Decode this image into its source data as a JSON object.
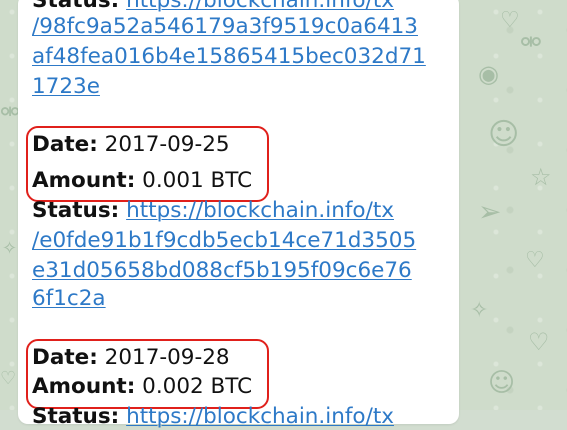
{
  "messages": [
    {
      "status_label": "Status:",
      "link_lines": [
        "https://blockchain.info/tx",
        "/98fc9a52a546179a3f9519c0a6413",
        "af48fea016b4e15865415bec032d71",
        "1723e"
      ]
    },
    {
      "date_label": "Date:",
      "date_value": "2017-09-25",
      "amount_label": "Amount:",
      "amount_value": "0.001 BTC",
      "status_label": "Status:",
      "link_lines": [
        "https://blockchain.info/tx",
        "/e0fde91b1f9cdb5ecb14ce71d3505",
        "e31d05658bd088cf5b195f09c6e76",
        "6f1c2a"
      ]
    },
    {
      "date_label": "Date:",
      "date_value": "2017-09-28",
      "amount_label": "Amount:",
      "amount_value": "0.002 BTC",
      "status_label": "Status:",
      "link_lines": [
        "https://blockchain.info/tx"
      ]
    }
  ],
  "highlight_color": "#e0201b",
  "link_color": "#2d79c7",
  "wallpaper_icons": [
    "fish-icon",
    "bone-icon",
    "cat-icon",
    "paper-plane-icon",
    "heart-icon",
    "star-icon"
  ]
}
